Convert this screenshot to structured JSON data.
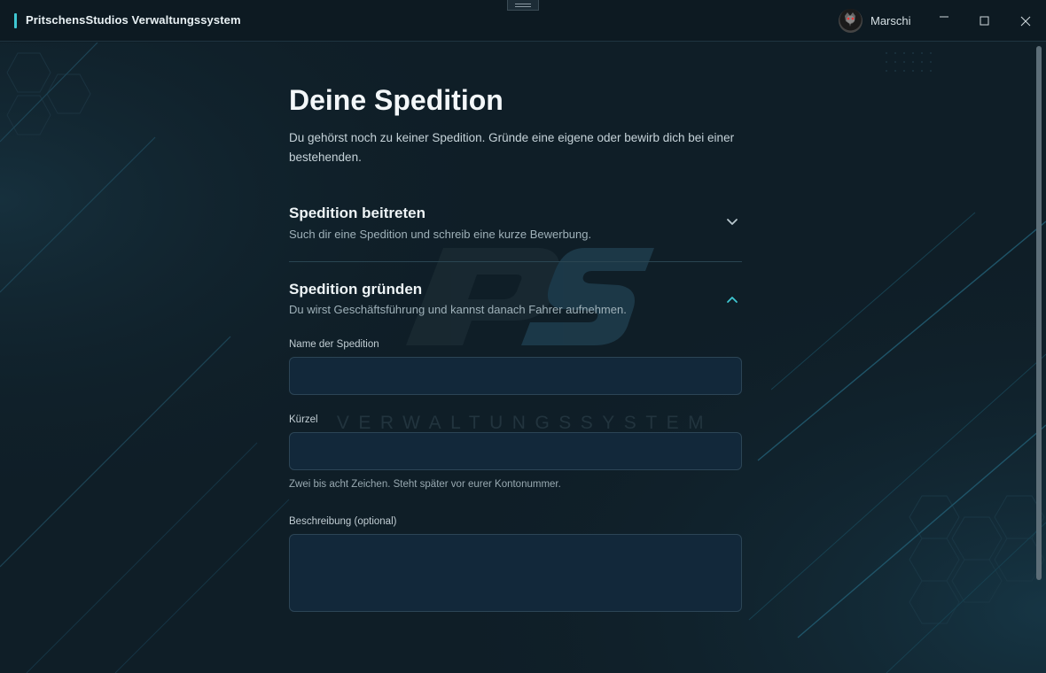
{
  "app": {
    "title": "PritschensStudios Verwaltungssystem",
    "user": "Marschi"
  },
  "window_controls": {
    "minimize_icon": "minimize-icon",
    "maximize_icon": "maximize-icon",
    "close_icon": "close-icon"
  },
  "watermark": {
    "logo": "PS",
    "text": "VERWALTUNGSSYSTEM"
  },
  "page": {
    "title": "Deine Spedition",
    "intro": "Du gehörst noch zu keiner Spedition. Gründe eine eigene oder bewirb dich bei einer bestehenden."
  },
  "sections": {
    "join": {
      "title": "Spedition beitreten",
      "subtitle": "Such dir eine Spedition und schreib eine kurze Bewerbung.",
      "expanded": false
    },
    "found": {
      "title": "Spedition gründen",
      "subtitle": "Du wirst Geschäftsführung und kannst danach Fahrer aufnehmen.",
      "expanded": true
    }
  },
  "form": {
    "name": {
      "label": "Name der Spedition",
      "value": ""
    },
    "short": {
      "label": "Kürzel",
      "value": "",
      "hint": "Zwei bis acht Zeichen. Steht später vor eurer Kontonummer."
    },
    "description": {
      "label": "Beschreibung (optional)",
      "value": ""
    }
  },
  "colors": {
    "accent": "#3fc7d2",
    "background": "#0f1e27",
    "input_bg": "#12283a"
  }
}
